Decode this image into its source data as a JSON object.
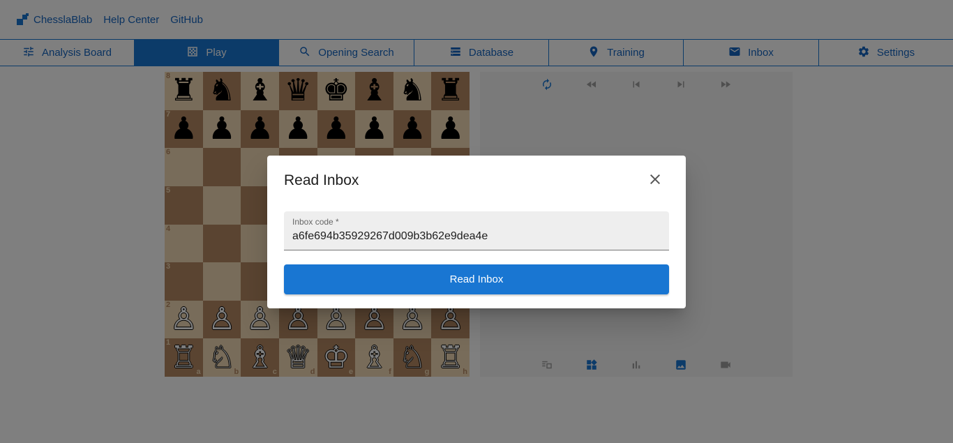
{
  "header": {
    "brand": "ChesslaBlab",
    "links": [
      "Help Center",
      "GitHub"
    ]
  },
  "nav": {
    "tabs": [
      {
        "label": "Analysis Board",
        "icon": "sliders-icon",
        "active": false
      },
      {
        "label": "Play",
        "icon": "board-icon",
        "active": true
      },
      {
        "label": "Opening Search",
        "icon": "search-icon",
        "active": false
      },
      {
        "label": "Database",
        "icon": "database-icon",
        "active": false
      },
      {
        "label": "Training",
        "icon": "training-icon",
        "active": false
      },
      {
        "label": "Inbox",
        "icon": "mail-icon",
        "active": false
      },
      {
        "label": "Settings",
        "icon": "gear-icon",
        "active": false
      }
    ]
  },
  "board": {
    "ranks": [
      "8",
      "7",
      "6",
      "5",
      "4",
      "3",
      "2",
      "1"
    ],
    "files": [
      "a",
      "b",
      "c",
      "d",
      "e",
      "f",
      "g",
      "h"
    ],
    "position": [
      [
        "♜",
        "♞",
        "♝",
        "♛",
        "♚",
        "♝",
        "♞",
        "♜"
      ],
      [
        "♟",
        "♟",
        "♟",
        "♟",
        "♟",
        "♟",
        "♟",
        "♟"
      ],
      [
        "",
        "",
        "",
        "",
        "",
        "",
        "",
        ""
      ],
      [
        "",
        "",
        "",
        "",
        "",
        "",
        "",
        ""
      ],
      [
        "",
        "",
        "",
        "",
        "",
        "",
        "",
        ""
      ],
      [
        "",
        "",
        "",
        "",
        "",
        "",
        "",
        ""
      ],
      [
        "♙",
        "♙",
        "♙",
        "♙",
        "♙",
        "♙",
        "♙",
        "♙"
      ],
      [
        "♖",
        "♘",
        "♗",
        "♕",
        "♔",
        "♗",
        "♘",
        "♖"
      ]
    ]
  },
  "panel": {
    "top_controls": [
      "flip-board-icon",
      "fast-rewind-icon",
      "first-move-icon",
      "last-move-icon",
      "fast-forward-icon"
    ],
    "bottom_controls": [
      "move-list-icon",
      "widgets-icon",
      "bar-chart-icon",
      "image-icon",
      "video-icon"
    ]
  },
  "dialog": {
    "title": "Read Inbox",
    "field_label": "Inbox code *",
    "field_value": "a6fe694b35929267d009b3b62e9dea4e",
    "button_label": "Read Inbox"
  },
  "colors": {
    "primary": "#1976d2",
    "board_light": "#f0d9b5",
    "board_dark": "#b58863"
  }
}
